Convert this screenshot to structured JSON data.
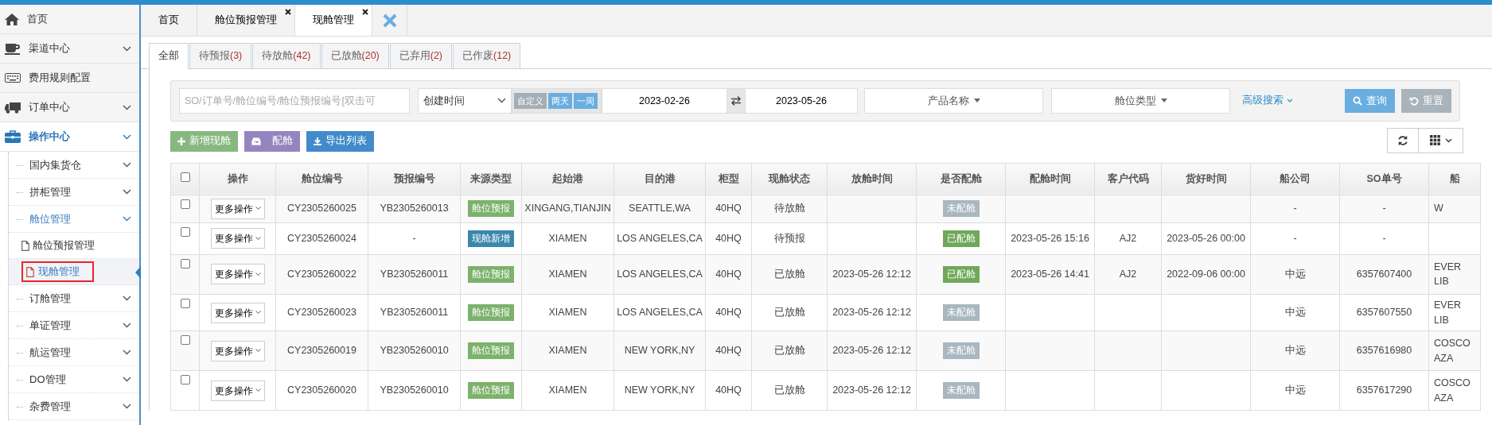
{
  "sidebar": {
    "items": [
      {
        "label": "首页",
        "kind": "link",
        "selected": false
      },
      {
        "label": "渠道中心",
        "kind": "group",
        "selected": false
      },
      {
        "label": "费用规则配置",
        "kind": "link",
        "selected": false
      },
      {
        "label": "订单中心",
        "kind": "group",
        "selected": false
      },
      {
        "label": "操作中心",
        "kind": "group",
        "selected": true,
        "children": [
          {
            "label": "国内集货仓",
            "selected": false
          },
          {
            "label": "拼柜管理",
            "selected": false
          },
          {
            "label": "舱位管理",
            "selected": true,
            "children": [
              {
                "label": "舱位预报管理",
                "selected": false,
                "annotated": false
              },
              {
                "label": "现舱管理",
                "selected": true,
                "annotated": true
              }
            ]
          },
          {
            "label": "订舱管理",
            "selected": false
          },
          {
            "label": "单证管理",
            "selected": false
          },
          {
            "label": "航运管理",
            "selected": false
          },
          {
            "label": "DO管理",
            "selected": false
          },
          {
            "label": "杂费管理",
            "selected": false
          }
        ]
      }
    ]
  },
  "page_tabs": [
    {
      "label": "首页",
      "closable": false,
      "selected": false
    },
    {
      "label": "舱位预报管理",
      "closable": true,
      "selected": false
    },
    {
      "label": "现舱管理",
      "closable": true,
      "selected": true
    }
  ],
  "status_tabs": [
    {
      "label": "全部",
      "selected": true
    },
    {
      "label": "待预报",
      "count": "(3)",
      "selected": false
    },
    {
      "label": "待放舱",
      "count": "(42)",
      "selected": false
    },
    {
      "label": "已放舱",
      "count": "(20)",
      "selected": false
    },
    {
      "label": "已弃用",
      "count": "(2)",
      "selected": false
    },
    {
      "label": "已作废",
      "count": "(12)",
      "selected": false
    }
  ],
  "filter": {
    "search_placeholder": "SO/订单号/舱位编号/舱位预报编号[双击可",
    "date_type": "创建时间",
    "quick_ranges": [
      {
        "label": "自定义",
        "selected": true
      },
      {
        "label": "两天",
        "selected": false
      },
      {
        "label": "一周",
        "selected": false
      }
    ],
    "date_from": "2023-02-26",
    "date_to": "2023-05-26",
    "product": "产品名称",
    "cabin_type": "舱位类型",
    "advanced": "高级搜索",
    "search_button": "查询",
    "reset_button": "重置"
  },
  "actions": [
    {
      "label": "新增现舱",
      "kind": "add"
    },
    {
      "label": "配舱",
      "kind": "assign"
    },
    {
      "label": "导出列表",
      "kind": "export"
    }
  ],
  "table": {
    "all_checked": false,
    "columns": [
      "操作",
      "舱位编号",
      "预报编号",
      "来源类型",
      "起始港",
      "目的港",
      "柜型",
      "现舱状态",
      "放舱时间",
      "是否配舱",
      "配舱时间",
      "客户代码",
      "货好时间",
      "船公司",
      "SO单号",
      "船"
    ],
    "rows": [
      {
        "checked": false,
        "action": "更多操作",
        "id": "CY2305260025",
        "forecast": "YB2305260013",
        "source": {
          "label": "舱位预报",
          "color": "#7cb26b"
        },
        "origin": "XINGANG,TIANJIN",
        "destination": "SEATTLE,WA",
        "container": "40HQ",
        "status": "待放舱",
        "release_time": "",
        "matched": {
          "label": "未配舱",
          "color": "#a9b7c1"
        },
        "match_time": "",
        "customer": "",
        "ready_time": "",
        "carrier": "-",
        "so": "-",
        "column_16": "W"
      },
      {
        "checked": false,
        "action": "更多操作",
        "id": "CY2305260024",
        "forecast": "-",
        "source": {
          "label": "现舱新增",
          "color": "#3a87ad"
        },
        "origin": "XIAMEN",
        "destination": "LOS ANGELES,CA",
        "container": "40HQ",
        "status": "待预报",
        "release_time": "",
        "matched": {
          "label": "已配舱",
          "color": "#6fa85a"
        },
        "match_time": "2023-05-26 15:16",
        "customer": "AJ2",
        "ready_time": "2023-05-26 00:00",
        "carrier": "-",
        "so": "-",
        "column_16": ""
      },
      {
        "checked": false,
        "action": "更多操作",
        "id": "CY2305260022",
        "forecast": "YB2305260011",
        "source": {
          "label": "舱位预报",
          "color": "#7cb26b"
        },
        "origin": "XIAMEN",
        "destination": "LOS ANGELES,CA",
        "container": "40HQ",
        "status": "已放舱",
        "release_time": "2023-05-26 12:12",
        "matched": {
          "label": "已配舱",
          "color": "#6fa85a"
        },
        "match_time": "2023-05-26 14:41",
        "customer": "AJ2",
        "ready_time": "2022-09-06 00:00",
        "carrier": "中远",
        "so": "6357607400",
        "column_16": "EVER LIB"
      },
      {
        "checked": false,
        "action": "更多操作",
        "id": "CY2305260023",
        "forecast": "YB2305260011",
        "source": {
          "label": "舱位预报",
          "color": "#7cb26b"
        },
        "origin": "XIAMEN",
        "destination": "LOS ANGELES,CA",
        "container": "40HQ",
        "status": "已放舱",
        "release_time": "2023-05-26 12:12",
        "matched": {
          "label": "未配舱",
          "color": "#a9b7c1"
        },
        "match_time": "",
        "customer": "",
        "ready_time": "",
        "carrier": "中远",
        "so": "6357607550",
        "column_16": "EVER LIB"
      },
      {
        "checked": false,
        "action": "更多操作",
        "id": "CY2305260019",
        "forecast": "YB2305260010",
        "source": {
          "label": "舱位预报",
          "color": "#7cb26b"
        },
        "origin": "XIAMEN",
        "destination": "NEW YORK,NY",
        "container": "40HQ",
        "status": "已放舱",
        "release_time": "2023-05-26 12:12",
        "matched": {
          "label": "未配舱",
          "color": "#a9b7c1"
        },
        "match_time": "",
        "customer": "",
        "ready_time": "",
        "carrier": "中远",
        "so": "6357616980",
        "column_16": "COSCO AZA"
      },
      {
        "checked": false,
        "action": "更多操作",
        "id": "CY2305260020",
        "forecast": "YB2305260010",
        "source": {
          "label": "舱位预报",
          "color": "#7cb26b"
        },
        "origin": "XIAMEN",
        "destination": "NEW YORK,NY",
        "container": "40HQ",
        "status": "已放舱",
        "release_time": "2023-05-26 12:12",
        "matched": {
          "label": "未配舱",
          "color": "#a9b7c1"
        },
        "match_time": "",
        "customer": "",
        "ready_time": "",
        "carrier": "中远",
        "so": "6357617290",
        "column_16": "COSCO AZA"
      }
    ]
  }
}
